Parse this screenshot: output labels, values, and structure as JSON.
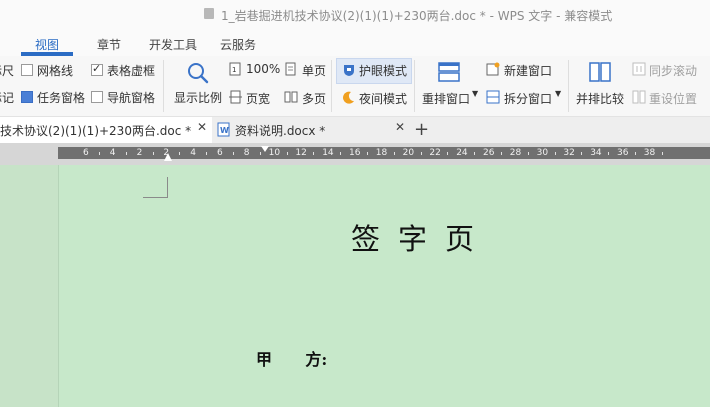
{
  "window": {
    "title": "1_岩巷掘进机技术协议(2)(1)(1)+230两台.doc * - WPS 文字 - 兼容模式"
  },
  "menu": {
    "tabs": [
      {
        "label": "视图",
        "active": true
      },
      {
        "label": "章节"
      },
      {
        "label": "开发工具"
      },
      {
        "label": "云服务"
      }
    ]
  },
  "ribbon": {
    "ruler_cut": "标尺",
    "gridlines": "网格线",
    "table_gridlines": "表格虚框",
    "marks_cut": "标记",
    "task_pane": "任务窗格",
    "nav_pane": "导航窗格",
    "zoom_label": "显示比例",
    "zoom_100": "100%",
    "page_width": "页宽",
    "single_page": "单页",
    "multi_page": "多页",
    "eye_mode": "护眼模式",
    "night_mode": "夜间模式",
    "arrange_window": "重排窗口",
    "new_window": "新建窗口",
    "split_window": "拆分窗口",
    "side_by_side": "并排比较",
    "sync_scroll": "同步滚动",
    "reset_position": "重设位置"
  },
  "doc_tabs": [
    {
      "label": "技术协议(2)(1)(1)+230两台.doc *",
      "active": true
    },
    {
      "label": "资料说明.docx *",
      "active": false
    }
  ],
  "ruler": {
    "labels": [
      "6",
      "4",
      "2",
      "2",
      "4",
      "6",
      "8",
      "10",
      "12",
      "14",
      "16",
      "18",
      "20",
      "22",
      "24",
      "26",
      "28",
      "30",
      "32",
      "34",
      "36",
      "38"
    ]
  },
  "document": {
    "title": "签字页",
    "party_a": "甲      方:"
  },
  "colors": {
    "accent": "#2b6cc4",
    "eye_mode_bg": "#c7e8ca",
    "ribbon_bg": "#f7f7f7"
  }
}
